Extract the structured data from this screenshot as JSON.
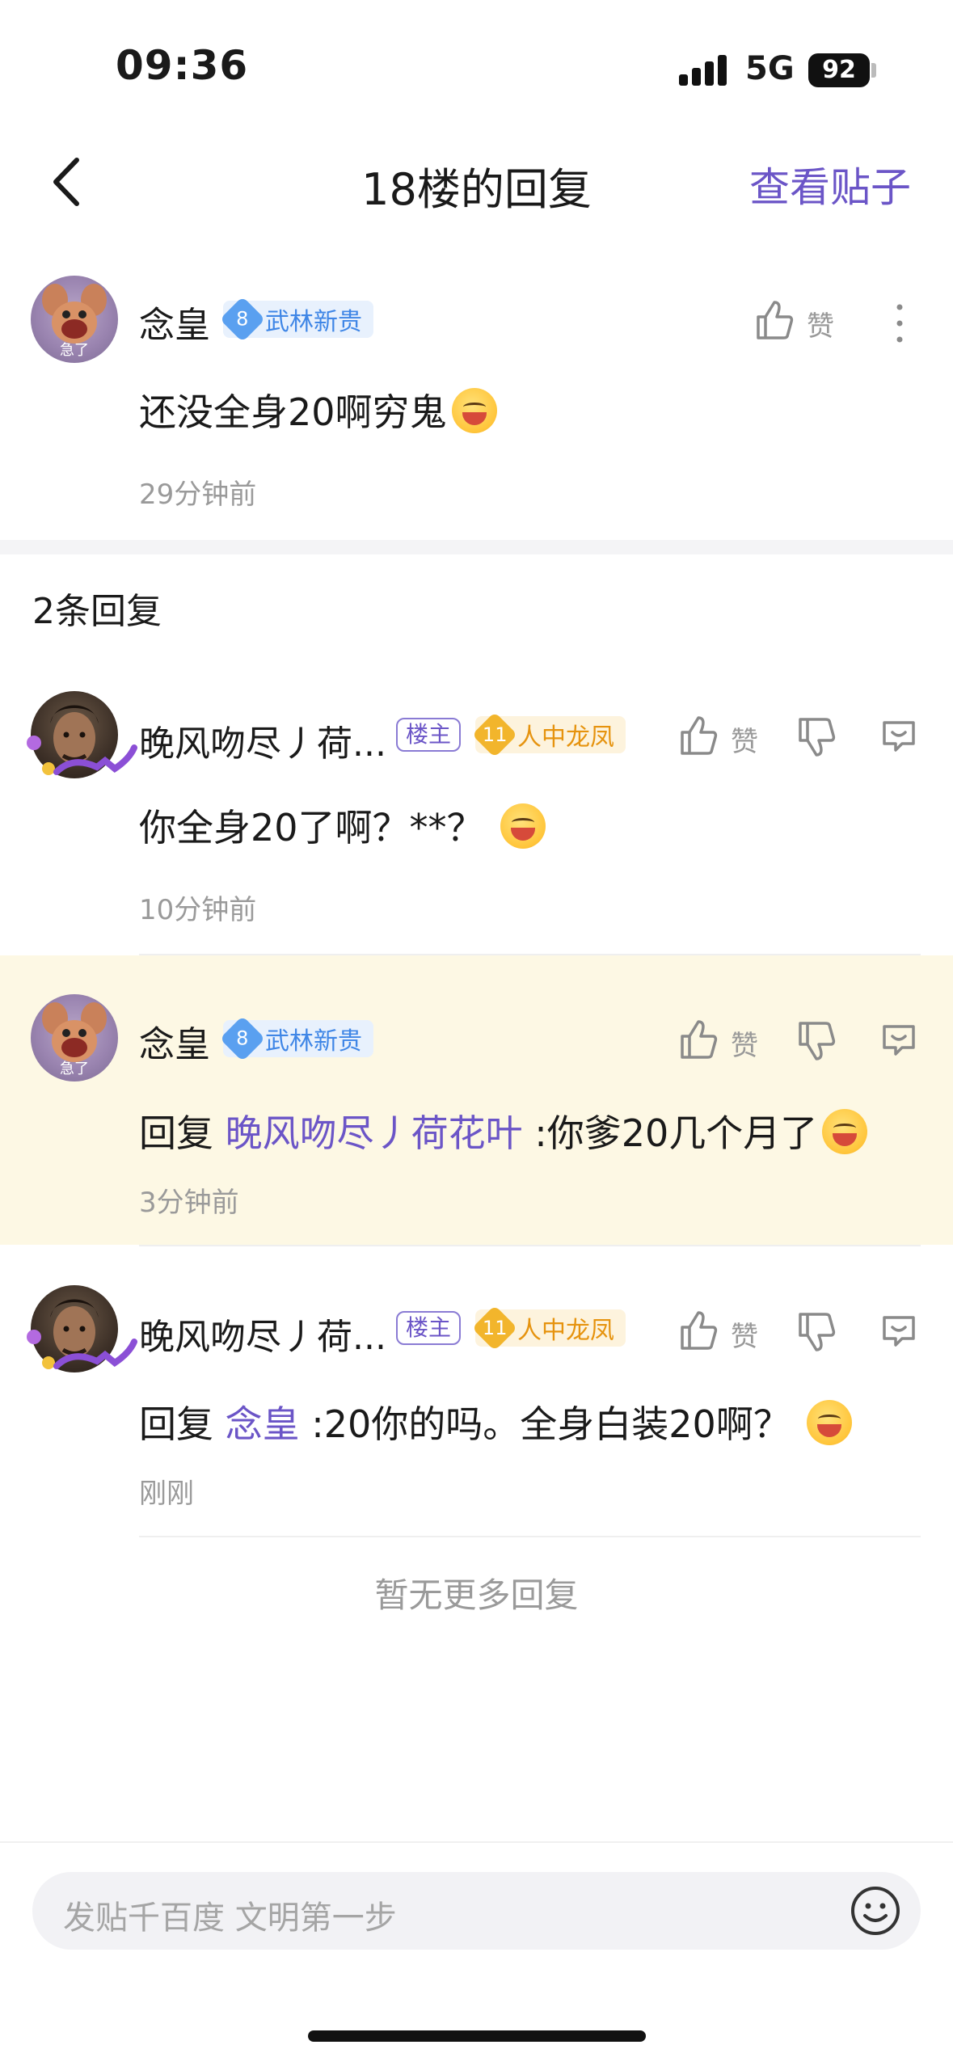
{
  "status_bar": {
    "time": "09:36",
    "network": "5G",
    "battery": "92"
  },
  "nav": {
    "title": "18楼的回复",
    "right_link": "查看贴子"
  },
  "main_post": {
    "username": "念皇",
    "level": "8",
    "level_title": "武林新贵",
    "avatar_caption": "急了",
    "like_label": "赞",
    "content": "还没全身20啊穷鬼",
    "time": "29分钟前"
  },
  "reply_count_label": "2条回复",
  "replies": [
    {
      "username": "晚风吻尽丿荷...",
      "owner_tag": "楼主",
      "level": "11",
      "level_title": "人中龙凤",
      "like_label": "赞",
      "content": "你全身20了啊？**？",
      "time": "10分钟前"
    },
    {
      "username": "念皇",
      "level": "8",
      "level_title": "武林新贵",
      "avatar_caption": "急了",
      "like_label": "赞",
      "reply_prefix": "回复",
      "mention": "晚风吻尽丿荷花叶",
      "content": ":你爹20几个月了",
      "time": "3分钟前"
    },
    {
      "username": "晚风吻尽丿荷...",
      "owner_tag": "楼主",
      "level": "11",
      "level_title": "人中龙凤",
      "like_label": "赞",
      "reply_prefix": "回复",
      "mention": "念皇",
      "content": ":20你的吗。全身白装20啊？",
      "time": "刚刚"
    }
  ],
  "footer": {
    "no_more": "暂无更多回复",
    "input_placeholder": "发贴千百度 文明第一步"
  },
  "colors": {
    "accent": "#6b55c7",
    "highlight_bg": "#fdf8e4",
    "level_blue": "#3f86e6",
    "level_gold": "#e6930e"
  },
  "icons": [
    "back-arrow-icon",
    "thumbs-up-icon",
    "thumbs-down-icon",
    "comment-icon",
    "more-icon",
    "emoji-icon"
  ]
}
